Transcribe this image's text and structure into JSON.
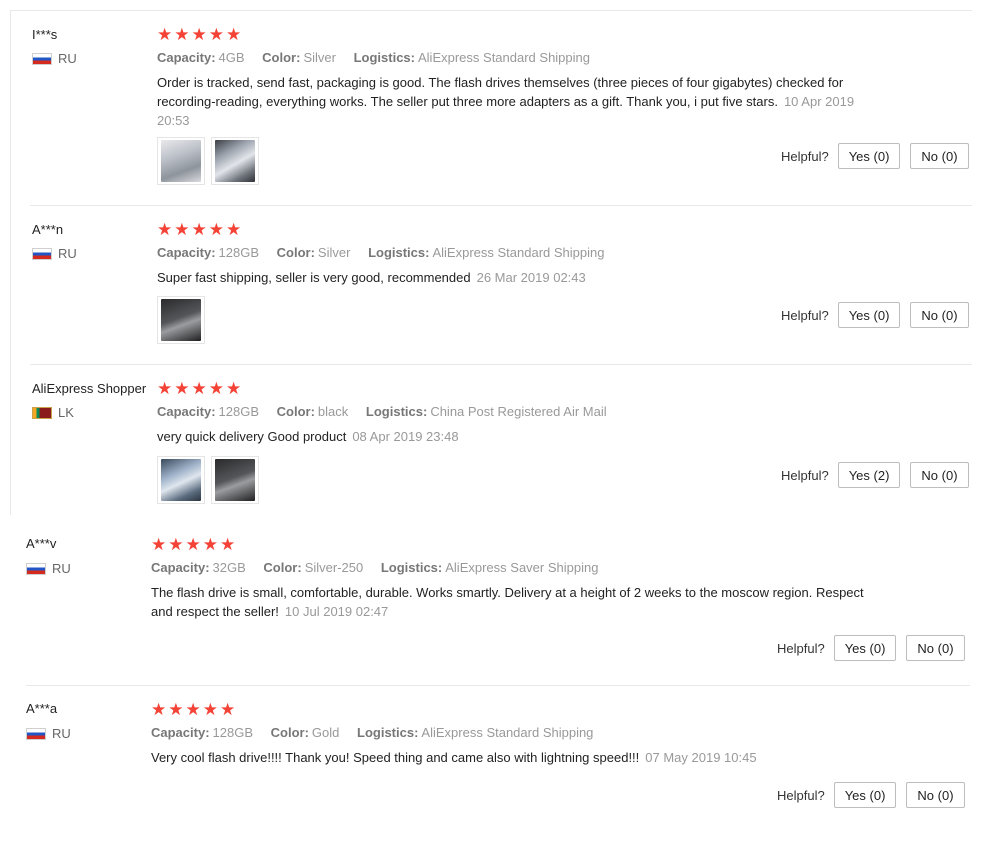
{
  "labels": {
    "capacity": "Capacity:",
    "color": "Color:",
    "logistics": "Logistics:",
    "helpful": "Helpful?"
  },
  "star_glyph": "★",
  "star_color": "#f44336",
  "reviews": [
    {
      "user": "I***s",
      "country": "RU",
      "flag": "ru-flag",
      "rating": 5,
      "capacity": "4GB",
      "color": "Silver",
      "logistics": "AliExpress Standard Shipping",
      "text": "Order is tracked, send fast, packaging is good. The flash drives themselves (three pieces of four gigabytes) checked for recording-reading, everything works. The seller put three more adapters as a gift. Thank you, i put five stars.",
      "date": "10 Apr 2019 20:53",
      "images": 2,
      "yes": "Yes (0)",
      "no": "No (0)"
    },
    {
      "user": "A***n",
      "country": "RU",
      "flag": "ru-flag",
      "rating": 5,
      "capacity": "128GB",
      "color": "Silver",
      "logistics": "AliExpress Standard Shipping",
      "text": "Super fast shipping, seller is very good, recommended",
      "date": "26 Mar 2019 02:43",
      "images": 1,
      "yes": "Yes (0)",
      "no": "No (0)"
    },
    {
      "user": "AliExpress Shopper",
      "country": "LK",
      "flag": "lk-flag",
      "rating": 5,
      "capacity": "128GB",
      "color": "black",
      "logistics": "China Post Registered Air Mail",
      "text": "very quick delivery Good product",
      "date": "08 Apr 2019 23:48",
      "images": 2,
      "yes": "Yes (2)",
      "no": "No (0)"
    },
    {
      "user": "A***v",
      "country": "RU",
      "flag": "ru-flag",
      "rating": 5,
      "capacity": "32GB",
      "color": "Silver-250",
      "logistics": "AliExpress Saver Shipping",
      "text": "The flash drive is small, comfortable, durable. Works smartly. Delivery at a height of 2 weeks to the moscow region. Respect and respect the seller!",
      "date": "10 Jul 2019 02:47",
      "images": 0,
      "yes": "Yes (0)",
      "no": "No (0)"
    },
    {
      "user": "A***a",
      "country": "RU",
      "flag": "ru-flag",
      "rating": 5,
      "capacity": "128GB",
      "color": "Gold",
      "logistics": "AliExpress Standard Shipping",
      "text": "Very cool flash drive!!!! Thank you! Speed thing and came also with lightning speed!!!",
      "date": "07 May 2019 10:45",
      "images": 0,
      "yes": "Yes (0)",
      "no": "No (0)"
    }
  ]
}
